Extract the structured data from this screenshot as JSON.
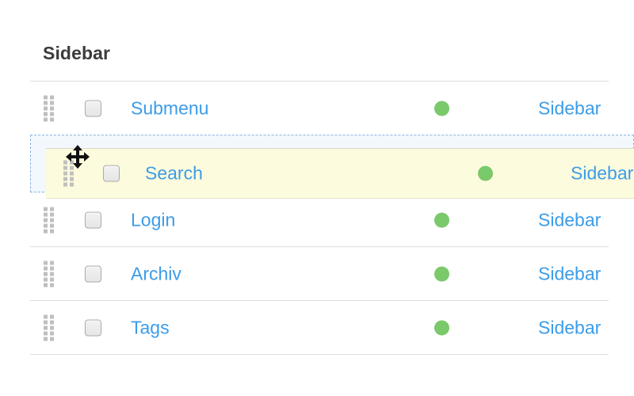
{
  "page": {
    "title": "Sidebar"
  },
  "table": {
    "status_color": "#7ac96b",
    "link_color": "#3c9ce8",
    "rows": [
      {
        "name": "Submenu",
        "status": "active",
        "region": "Sidebar"
      },
      {
        "name": "Login",
        "status": "active",
        "region": "Sidebar"
      },
      {
        "name": "Archiv",
        "status": "active",
        "region": "Sidebar"
      },
      {
        "name": "Tags",
        "status": "active",
        "region": "Sidebar"
      }
    ]
  },
  "drag": {
    "dragged_row": {
      "name": "Search",
      "status": "active",
      "region": "Sidebar"
    },
    "placeholder_fill": "#f2f8fd",
    "placeholder_border": "#8bb6dd",
    "dragged_fill": "#fdfbdd",
    "cursor": "move-cursor"
  }
}
